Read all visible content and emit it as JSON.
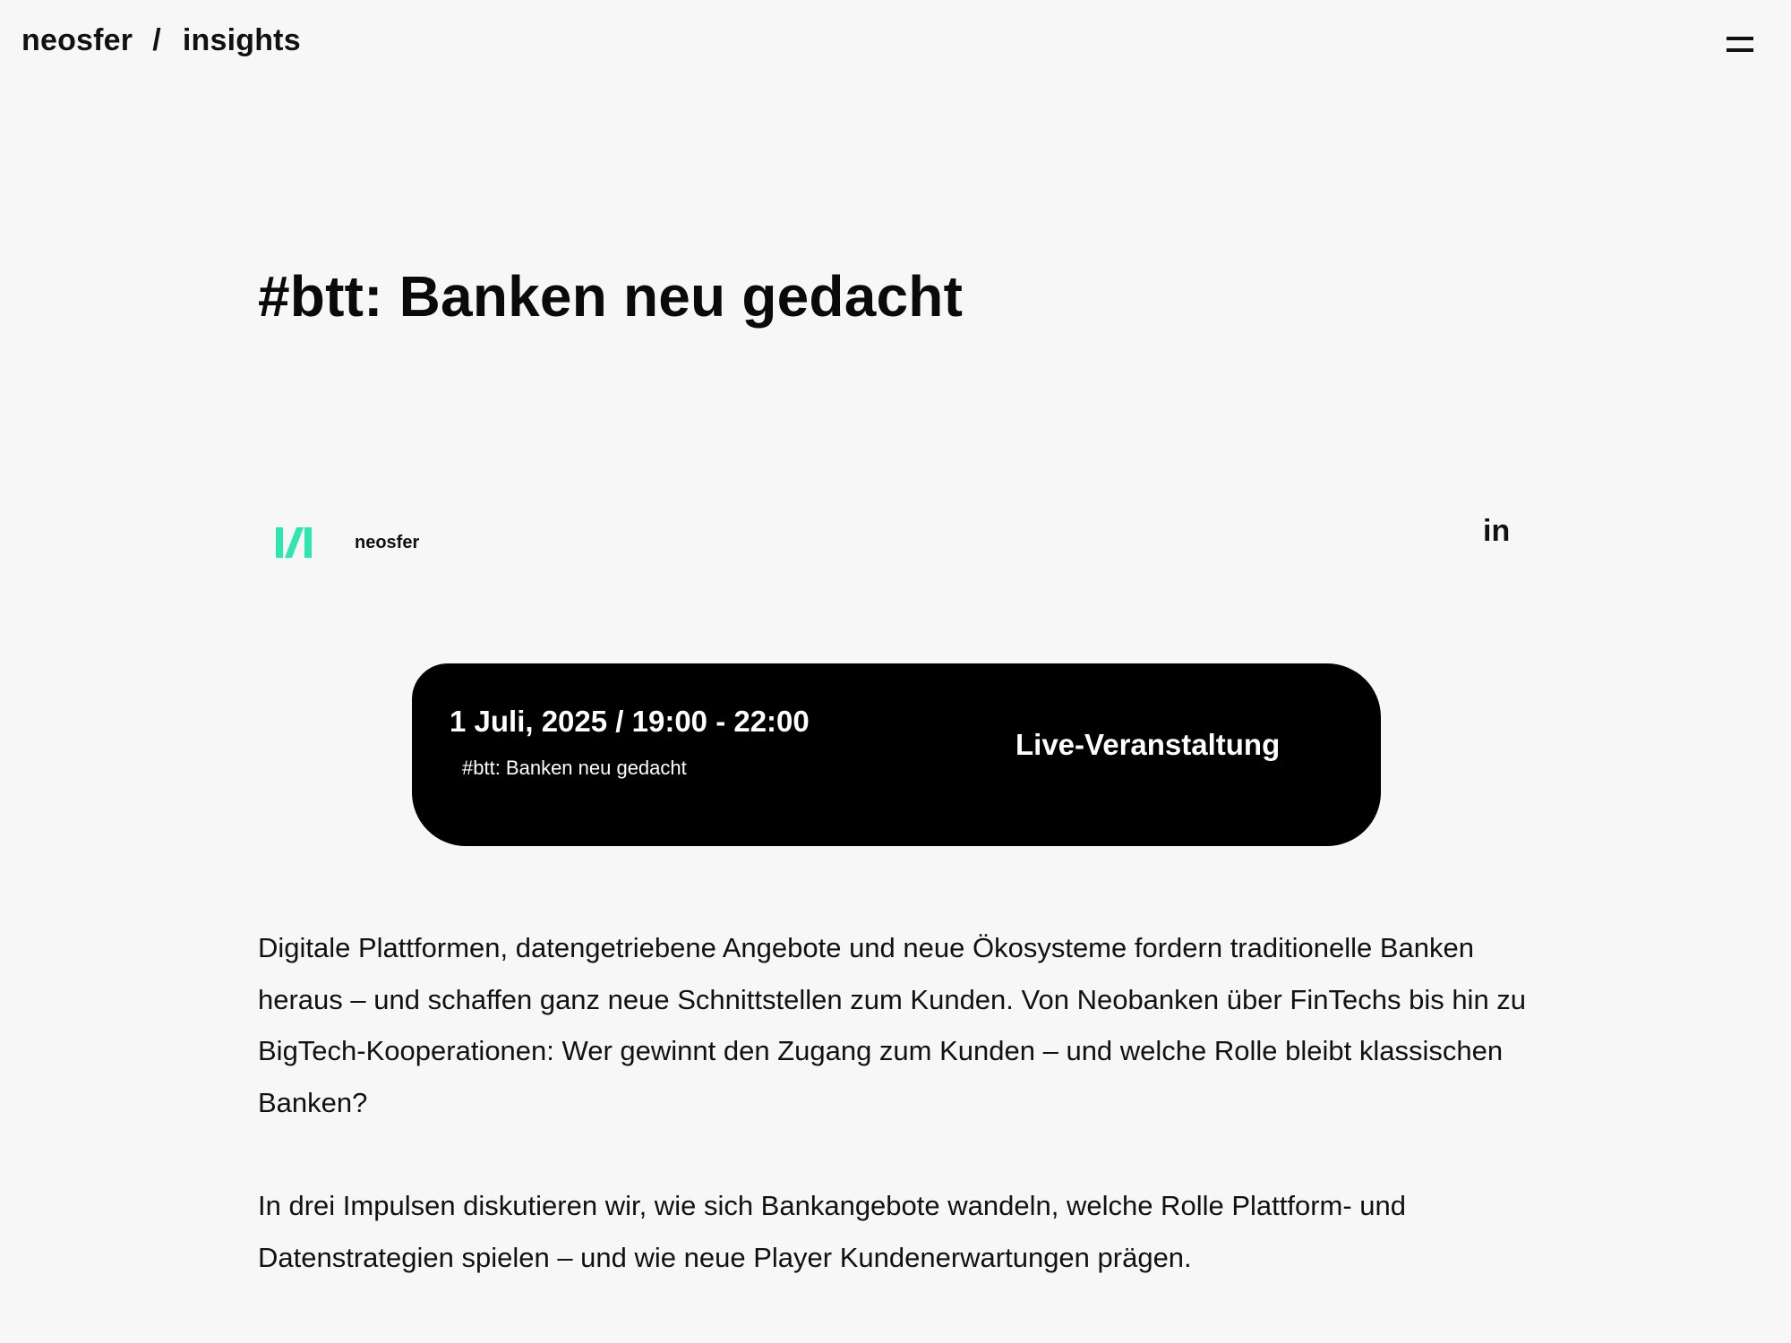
{
  "header": {
    "brand_name": "neosfer",
    "separator": "/",
    "section": "insights",
    "menu_icon": "hamburger-menu-icon"
  },
  "article": {
    "title": "#btt: Banken neu gedacht",
    "author": {
      "name": "neosfer",
      "logo_icon": "neosfer-logo-icon",
      "logo_color": "#2ee6b0"
    },
    "share_label": "in"
  },
  "event": {
    "date_time": "1 Juli, 2025 / 19:00 - 22:00",
    "subtitle": "#btt: Banken neu gedacht",
    "type": "Live-Veranstaltung",
    "background": "#000000"
  },
  "body": {
    "paragraphs": [
      "Digitale Plattformen, datengetriebene Angebote und neue Ökosysteme fordern traditionelle Banken heraus – und schaffen ganz neue Schnittstellen zum Kunden. Von Neobanken über FinTechs bis hin zu BigTech-Kooperationen: Wer gewinnt den Zugang zum Kunden – und welche Rolle bleibt klassischen Banken?",
      "In drei Impulsen diskutieren wir, wie sich Bankangebote wandeln, welche Rolle Plattform- und Datenstrategien spielen – und wie neue Player Kundenerwartungen prägen."
    ]
  },
  "colors": {
    "page_background": "#f7f7f7",
    "text": "#111111",
    "accent": "#2ee6b0"
  }
}
